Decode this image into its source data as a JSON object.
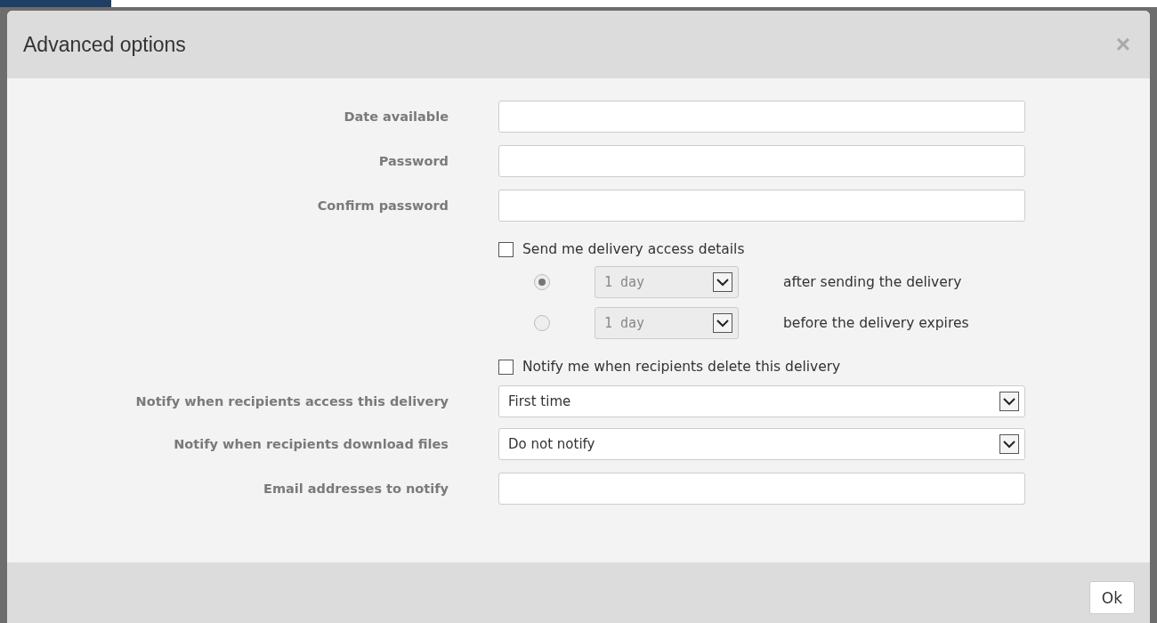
{
  "dialog": {
    "title": "Advanced options",
    "close": "×"
  },
  "rows": [
    {
      "kind": "text",
      "label": "Date available"
    },
    {
      "kind": "text",
      "label": "Password"
    },
    {
      "kind": "text",
      "label": "Confirm password"
    },
    {
      "kind": "checkbox",
      "label": "Send me delivery access details",
      "checked": false
    },
    {
      "kind": "radio",
      "selected": true,
      "disabled": true,
      "label": "after sending the delivery",
      "dropdown": {
        "value": "1 day"
      }
    },
    {
      "kind": "radio",
      "selected": false,
      "disabled": true,
      "label": "before the delivery expires",
      "dropdown": {
        "value": "1 day"
      }
    },
    {
      "kind": "checkbox",
      "label": "Notify me when recipients delete this delivery",
      "checked": false
    },
    {
      "kind": "select",
      "label": "Notify when recipients access this delivery",
      "value": "First time"
    },
    {
      "kind": "select",
      "label": "Notify when recipients download files",
      "value": "Do not notify"
    },
    {
      "kind": "text",
      "label": "Email addresses to notify"
    }
  ],
  "buttons": [
    "Ok"
  ]
}
